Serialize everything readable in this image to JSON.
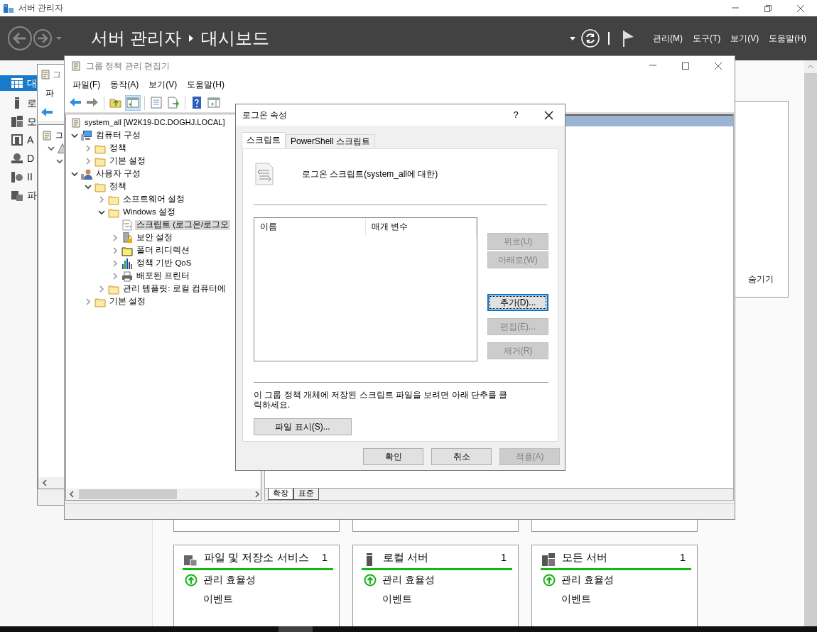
{
  "server_manager": {
    "title": "서버 관리자",
    "breadcrumb": [
      "서버 관리자",
      "대시보드"
    ],
    "menu": [
      "관리(M)",
      "도구(T)",
      "보기(V)",
      "도움말(H)"
    ],
    "sidebar": {
      "items": [
        {
          "label": "대",
          "selected": true
        },
        {
          "label": "로",
          "selected": false
        },
        {
          "label": "모",
          "selected": false
        },
        {
          "label": "A",
          "selected": false
        },
        {
          "label": "D",
          "selected": false
        },
        {
          "label": "II",
          "selected": false
        },
        {
          "label": "파",
          "selected": false
        }
      ]
    },
    "welcome": {
      "hide_link": "숨기기"
    },
    "tiles": [
      {
        "title": "파일 및 저장소 서비스",
        "count": "1",
        "rows": [
          {
            "label": "관리 효율성",
            "kind": "status"
          },
          {
            "label": "이벤트",
            "kind": "plain"
          }
        ]
      },
      {
        "title": "로컬 서버",
        "count": "1",
        "rows": [
          {
            "label": "관리 효율성",
            "kind": "status"
          },
          {
            "label": "이벤트",
            "kind": "plain"
          }
        ]
      },
      {
        "title": "모든 서버",
        "count": "1",
        "rows": [
          {
            "label": "관리 효율성",
            "kind": "status"
          },
          {
            "label": "이벤트",
            "kind": "plain"
          }
        ]
      }
    ]
  },
  "back_editor": {
    "title": "그",
    "menu": [
      "파"
    ],
    "tree": [
      {
        "label": "그",
        "children": [
          {
            "expanded": true,
            "children": [
              {
                "expanded": true
              }
            ]
          }
        ]
      }
    ]
  },
  "editor": {
    "title": "그룹 정책 관리 편집기",
    "menu": [
      "파일(F)",
      "동작(A)",
      "보기(V)",
      "도움말(H)"
    ],
    "toolbar": [
      [
        {
          "kind": "back",
          "pressed": false
        },
        {
          "kind": "forward",
          "pressed": false
        }
      ],
      [
        {
          "kind": "up",
          "pressed": false
        },
        {
          "kind": "tree",
          "pressed": true
        }
      ],
      [
        {
          "kind": "properties",
          "pressed": false
        },
        {
          "kind": "export",
          "pressed": false
        }
      ],
      [
        {
          "kind": "help",
          "pressed": false
        },
        {
          "kind": "console",
          "pressed": false
        }
      ]
    ],
    "tree": [
      {
        "label": "system_all [W2K19-DC.DOGHJ.LOCAL]",
        "kind": "gpo",
        "selected": false,
        "children": [
          {
            "label": "컴퓨터 구성",
            "kind": "computer",
            "expanded": true,
            "selected": false,
            "children": [
              {
                "label": "정책",
                "kind": "folder",
                "expanded": false,
                "selected": false
              },
              {
                "label": "기본 설정",
                "kind": "folder",
                "expanded": false,
                "selected": false
              }
            ]
          },
          {
            "label": "사용자 구성",
            "kind": "user",
            "expanded": true,
            "selected": false,
            "children": [
              {
                "label": "정책",
                "kind": "folder",
                "expanded": true,
                "selected": false,
                "children": [
                  {
                    "label": "소프트웨어 설정",
                    "kind": "folder",
                    "expanded": false,
                    "selected": false
                  },
                  {
                    "label": "Windows 설정",
                    "kind": "folder",
                    "expanded": true,
                    "selected": false,
                    "children": [
                      {
                        "label": "스크립트 (로그온/로그오",
                        "kind": "script",
                        "selected": true
                      },
                      {
                        "label": "보안 설정",
                        "kind": "security",
                        "expanded": false,
                        "selected": false
                      },
                      {
                        "label": "폴더 리디렉션",
                        "kind": "redirect",
                        "expanded": false,
                        "selected": false
                      },
                      {
                        "label": "정책 기반 QoS",
                        "kind": "qos",
                        "expanded": false,
                        "selected": false
                      },
                      {
                        "label": "배포된 프린터",
                        "kind": "printer",
                        "expanded": false,
                        "selected": false
                      }
                    ]
                  },
                  {
                    "label": "관리 템플릿: 로컬 컴퓨터에",
                    "kind": "folder",
                    "expanded": false,
                    "selected": false
                  }
                ]
              },
              {
                "label": "기본 설정",
                "kind": "folder",
                "expanded": false,
                "selected": false
              }
            ]
          }
        ]
      }
    ],
    "tabs": [
      {
        "label": "확장",
        "selected": true
      },
      {
        "label": "표준",
        "selected": false
      }
    ]
  },
  "dialog": {
    "title": "로그온 속성",
    "help": "?",
    "tabs": [
      {
        "label": "스크립트",
        "selected": true
      },
      {
        "label": "PowerShell 스크립트",
        "selected": false
      }
    ],
    "heading": "로그온 스크립트(system_all에 대한)",
    "columns": [
      "이름",
      "매개 변수"
    ],
    "side_buttons": [
      [
        {
          "label": "위로(U)",
          "disabled": true,
          "focused": false
        },
        {
          "label": "아래로(W)",
          "disabled": true,
          "focused": false
        }
      ],
      [
        {
          "label": "추가(D)...",
          "disabled": false,
          "focused": true
        },
        {
          "label": "편집(E)...",
          "disabled": true,
          "focused": false
        },
        {
          "label": "제거(R)",
          "disabled": true,
          "focused": false
        }
      ]
    ],
    "note": "이 그룹 정책 개체에 저장된 스크립트 파일을 보려면 아래 단추를 클릭하세요.",
    "show_files_button": "파일 표시(S)...",
    "buttons": [
      {
        "label": "확인",
        "disabled": false
      },
      {
        "label": "취소",
        "disabled": false
      },
      {
        "label": "적용(A)",
        "disabled": true
      }
    ]
  }
}
